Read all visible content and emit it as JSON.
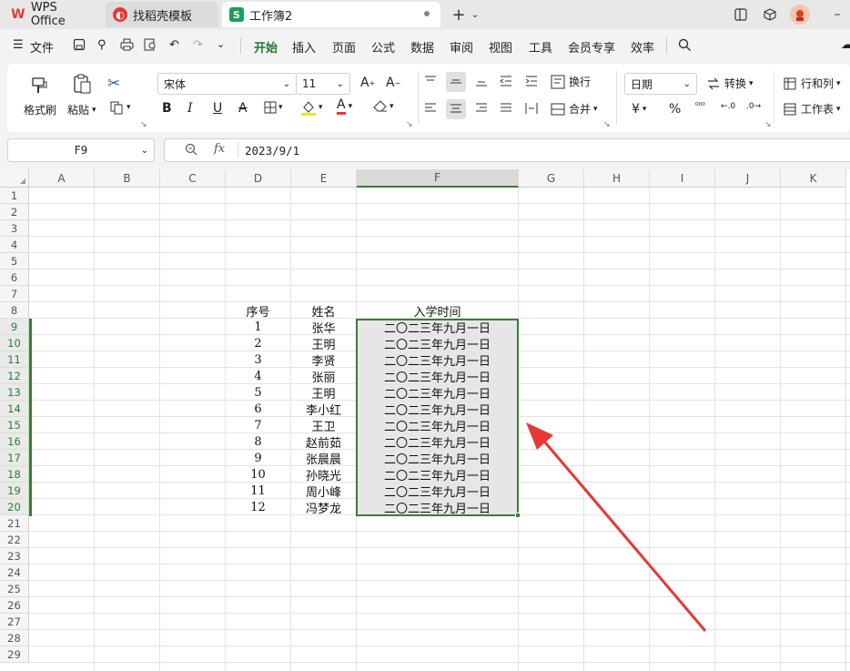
{
  "tabs": [
    {
      "label": "WPS Office",
      "icon": "wps-logo-icon"
    },
    {
      "label": "找稻壳模板",
      "icon": "docer-icon"
    },
    {
      "label": "工作簿2",
      "icon": "spreadsheet-icon"
    }
  ],
  "menu": {
    "file": "文件",
    "items": [
      "开始",
      "插入",
      "页面",
      "公式",
      "数据",
      "审阅",
      "视图",
      "工具",
      "会员专享",
      "效率"
    ],
    "active": "开始"
  },
  "ribbon": {
    "format_painter": "格式刷",
    "paste": "粘贴",
    "font_name": "宋体",
    "font_size": "11",
    "wrap": "换行",
    "merge": "合并",
    "number_format": "日期",
    "convert": "转换",
    "rows_cols": "行和列",
    "worksheet": "工作表",
    "currency_symbol": "¥",
    "percent_symbol": "%"
  },
  "formula_bar": {
    "name_box": "F9",
    "fx": "fx",
    "value": "2023/9/1"
  },
  "sheet": {
    "columns": [
      "A",
      "B",
      "C",
      "D",
      "E",
      "F",
      "G",
      "H",
      "I",
      "J",
      "K"
    ],
    "rows": [
      "1",
      "2",
      "3",
      "4",
      "5",
      "6",
      "7",
      "8",
      "9",
      "10",
      "11",
      "12",
      "13",
      "14",
      "15",
      "16",
      "17",
      "18",
      "19",
      "20",
      "21",
      "22",
      "23",
      "24",
      "25",
      "26",
      "27",
      "28",
      "29"
    ],
    "headers": {
      "seq": "序号",
      "name": "姓名",
      "date": "入学时间"
    },
    "records": [
      {
        "seq": "1",
        "name": "张华",
        "date": "二〇二三年九月一日"
      },
      {
        "seq": "2",
        "name": "王明",
        "date": "二〇二三年九月一日"
      },
      {
        "seq": "3",
        "name": "李贤",
        "date": "二〇二三年九月一日"
      },
      {
        "seq": "4",
        "name": "张丽",
        "date": "二〇二三年九月一日"
      },
      {
        "seq": "5",
        "name": "王明",
        "date": "二〇二三年九月一日"
      },
      {
        "seq": "6",
        "name": "李小红",
        "date": "二〇二三年九月一日"
      },
      {
        "seq": "7",
        "name": "王卫",
        "date": "二〇二三年九月一日"
      },
      {
        "seq": "8",
        "name": "赵前茹",
        "date": "二〇二三年九月一日"
      },
      {
        "seq": "9",
        "name": "张晨晨",
        "date": "二〇二三年九月一日"
      },
      {
        "seq": "10",
        "name": "孙晓光",
        "date": "二〇二三年九月一日"
      },
      {
        "seq": "11",
        "name": "周小峰",
        "date": "二〇二三年九月一日"
      },
      {
        "seq": "12",
        "name": "冯梦龙",
        "date": "二〇二三年九月一日"
      }
    ]
  },
  "colors": {
    "accent_green": "#2e7d32",
    "selection_border": "#3a7d34",
    "annotation_arrow": "#e53935",
    "wps_red": "#e53935"
  }
}
